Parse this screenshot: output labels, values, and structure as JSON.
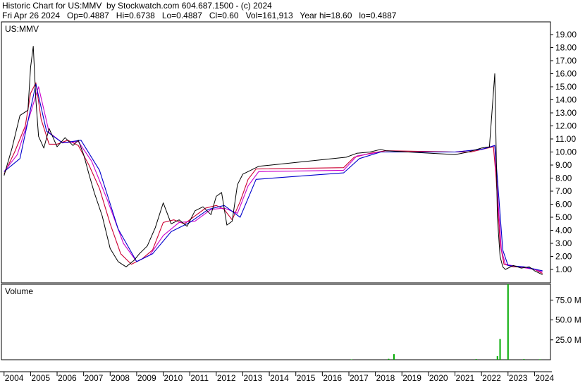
{
  "header": {
    "line1": "Historic Chart for US:MMV  by Stockwatch.com 604.687.1500 - (c) 2024",
    "line2": "Fri Apr 26 2024   Op=0.4887   Hi=0.6738   Lo=0.4887   Cl=0.60   Vol=161,913   Year hi=18.60   lo=0.4887"
  },
  "colors": {
    "price": "#000000",
    "ma_short": "#cc0033",
    "ma_mid": "#cc00cc",
    "ma_long": "#0000cc",
    "volume_bar": "#00aa00",
    "grid": "#000000"
  },
  "chart_data": [
    {
      "type": "line",
      "title": "US:MMV",
      "series": [],
      "x": [
        2004.0,
        2004.3,
        2004.6,
        2004.9,
        2005.0,
        2005.1,
        2005.2,
        2005.3,
        2005.5,
        2005.7,
        2006.0,
        2006.3,
        2006.6,
        2006.8,
        2007.0,
        2007.2,
        2007.4,
        2007.7,
        2008.0,
        2008.3,
        2008.6,
        2008.9,
        2009.1,
        2009.4,
        2009.7,
        2010.0,
        2010.3,
        2010.6,
        2010.9,
        2011.2,
        2011.5,
        2011.8,
        2012.0,
        2012.2,
        2012.4,
        2012.6,
        2012.8,
        2013.0,
        2013.3,
        2013.6,
        2016.9,
        2017.3,
        2017.8,
        2018.2,
        2018.4,
        2021.0,
        2021.5,
        2022.0,
        2022.3,
        2022.5,
        2022.6,
        2022.7,
        2022.8,
        2022.9,
        2023.2,
        2023.5,
        2023.8,
        2024.0,
        2024.3
      ],
      "y": [
        8.2,
        10.3,
        12.8,
        13.2,
        16.5,
        18.1,
        14.0,
        11.2,
        10.3,
        11.8,
        10.4,
        11.1,
        10.5,
        10.9,
        9.8,
        8.3,
        6.9,
        5.1,
        2.6,
        1.6,
        1.2,
        1.7,
        2.2,
        2.8,
        4.2,
        6.1,
        4.5,
        4.8,
        4.3,
        5.5,
        5.8,
        5.2,
        6.6,
        6.9,
        4.4,
        4.7,
        7.5,
        8.3,
        8.6,
        8.9,
        9.6,
        9.9,
        10.0,
        10.2,
        10.1,
        9.8,
        10.0,
        10.3,
        10.4,
        16.0,
        5.0,
        2.0,
        1.2,
        1.0,
        1.3,
        1.1,
        1.2,
        0.9,
        0.6
      ],
      "ylim": [
        0,
        20
      ],
      "yticks": [
        "1.00",
        "2.00",
        "3.00",
        "4.00",
        "5.00",
        "6.00",
        "7.00",
        "8.00",
        "9.00",
        "10.00",
        "11.00",
        "12.00",
        "13.00",
        "14.00",
        "15.00",
        "16.00",
        "17.00",
        "18.00",
        "19.00"
      ],
      "grid": false,
      "averages": [
        {
          "x": [
            2004.0,
            2004.4,
            2004.8,
            2005.0,
            2005.2,
            2005.4,
            2005.7,
            2006.0,
            2006.4,
            2006.8,
            2007.2,
            2007.6,
            2008.0,
            2008.4,
            2008.8,
            2009.2,
            2009.6,
            2010.0,
            2010.4,
            2010.8,
            2011.2,
            2011.6,
            2012.0,
            2012.3,
            2012.6,
            2012.9,
            2013.2,
            2013.5,
            2016.8,
            2017.2,
            2017.8,
            2018.4,
            2021.0,
            2021.6,
            2022.0,
            2022.45,
            2022.55,
            2022.7,
            2022.85,
            2023.2,
            2023.6,
            2024.0,
            2024.3
          ],
          "y": [
            8.3,
            10.0,
            12.0,
            14.5,
            15.3,
            12.5,
            10.6,
            10.6,
            10.9,
            10.5,
            9.0,
            7.2,
            4.5,
            2.2,
            1.4,
            1.8,
            2.5,
            4.6,
            4.8,
            4.5,
            5.1,
            5.7,
            5.9,
            5.6,
            4.8,
            6.2,
            7.9,
            8.7,
            8.8,
            9.6,
            9.9,
            10.1,
            10.0,
            10.0,
            10.2,
            10.4,
            8.0,
            3.0,
            1.4,
            1.2,
            1.2,
            1.0,
            0.7
          ]
        },
        {
          "x": [
            2004.0,
            2004.5,
            2005.0,
            2005.3,
            2005.7,
            2006.2,
            2006.8,
            2007.3,
            2007.9,
            2008.5,
            2009.0,
            2009.5,
            2010.0,
            2010.6,
            2011.2,
            2011.8,
            2012.3,
            2012.8,
            2013.2,
            2013.6,
            2016.8,
            2017.3,
            2018.2,
            2021.0,
            2022.0,
            2022.5,
            2022.6,
            2022.75,
            2022.9,
            2023.4,
            2024.0,
            2024.3
          ],
          "y": [
            8.5,
            9.8,
            13.0,
            15.0,
            11.5,
            10.7,
            10.8,
            9.3,
            6.3,
            3.0,
            1.6,
            2.1,
            3.6,
            4.6,
            4.7,
            5.6,
            5.7,
            5.3,
            7.4,
            8.5,
            8.6,
            9.7,
            10.0,
            10.0,
            10.2,
            10.5,
            7.0,
            2.5,
            1.4,
            1.2,
            1.0,
            0.8
          ]
        },
        {
          "x": [
            2004.0,
            2004.6,
            2005.2,
            2005.6,
            2006.2,
            2006.9,
            2007.6,
            2008.3,
            2009.0,
            2009.6,
            2010.3,
            2011.0,
            2011.7,
            2012.3,
            2012.9,
            2013.5,
            2016.8,
            2017.4,
            2018.2,
            2021.0,
            2022.0,
            2022.5,
            2022.6,
            2022.8,
            2023.0,
            2023.6,
            2024.3
          ],
          "y": [
            8.5,
            9.5,
            15.2,
            11.6,
            10.7,
            10.9,
            8.6,
            4.1,
            1.6,
            2.2,
            3.9,
            4.6,
            5.6,
            5.9,
            5.0,
            7.9,
            8.4,
            9.5,
            10.0,
            10.0,
            10.2,
            10.5,
            8.0,
            2.5,
            1.3,
            1.2,
            0.9
          ]
        }
      ]
    },
    {
      "type": "bar",
      "title": "Volume",
      "x": [
        2017.1,
        2018.5,
        2018.7,
        2021.8,
        2022.6,
        2022.7,
        2023.0,
        2023.6,
        2024.2
      ],
      "values": [
        0.5,
        1.2,
        7.0,
        0.8,
        4.5,
        26.0,
        95.0,
        0.8,
        0.6
      ],
      "ylim": [
        0,
        100
      ],
      "yticks": [
        "25.0 M",
        "50.0 M",
        "75.0 M"
      ],
      "xticks": [
        "2004",
        "2005",
        "2006",
        "2007",
        "2008",
        "2009",
        "2010",
        "2011",
        "2012",
        "2013",
        "2014",
        "2015",
        "2016",
        "2017",
        "2018",
        "2019",
        "2020",
        "2021",
        "2022",
        "2023",
        "2024"
      ]
    }
  ]
}
